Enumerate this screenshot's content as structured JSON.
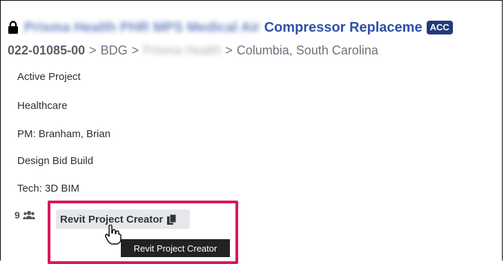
{
  "header": {
    "blurred_title": "Prisma Health PHR MPS Medical Air",
    "title": "Compressor Replaceme",
    "badge": "ACC"
  },
  "breadcrumb": {
    "project_id": "022-01085-00",
    "sep1": ">",
    "division": "BDG",
    "sep2": ">",
    "client_blurred": "Prisma Health",
    "sep3": ">",
    "location": "Columbia, South Carolina"
  },
  "details": {
    "status": "Active Project",
    "market": "Healthcare",
    "pm": "PM: Branham, Brian",
    "delivery": "Design Bid Build",
    "tech": "Tech: 3D BIM"
  },
  "team": {
    "count": "9"
  },
  "chip": {
    "label": "Revit Project Creator"
  },
  "tooltip": {
    "text": "Revit Project Creator"
  },
  "icons": {
    "lock": "lock-icon",
    "people": "people-icon",
    "copy": "copy-icon",
    "cursor": "hand-pointer-icon"
  },
  "colors": {
    "title": "#2f51a6",
    "badge": "#243a7a",
    "highlight": "#d8185a"
  }
}
